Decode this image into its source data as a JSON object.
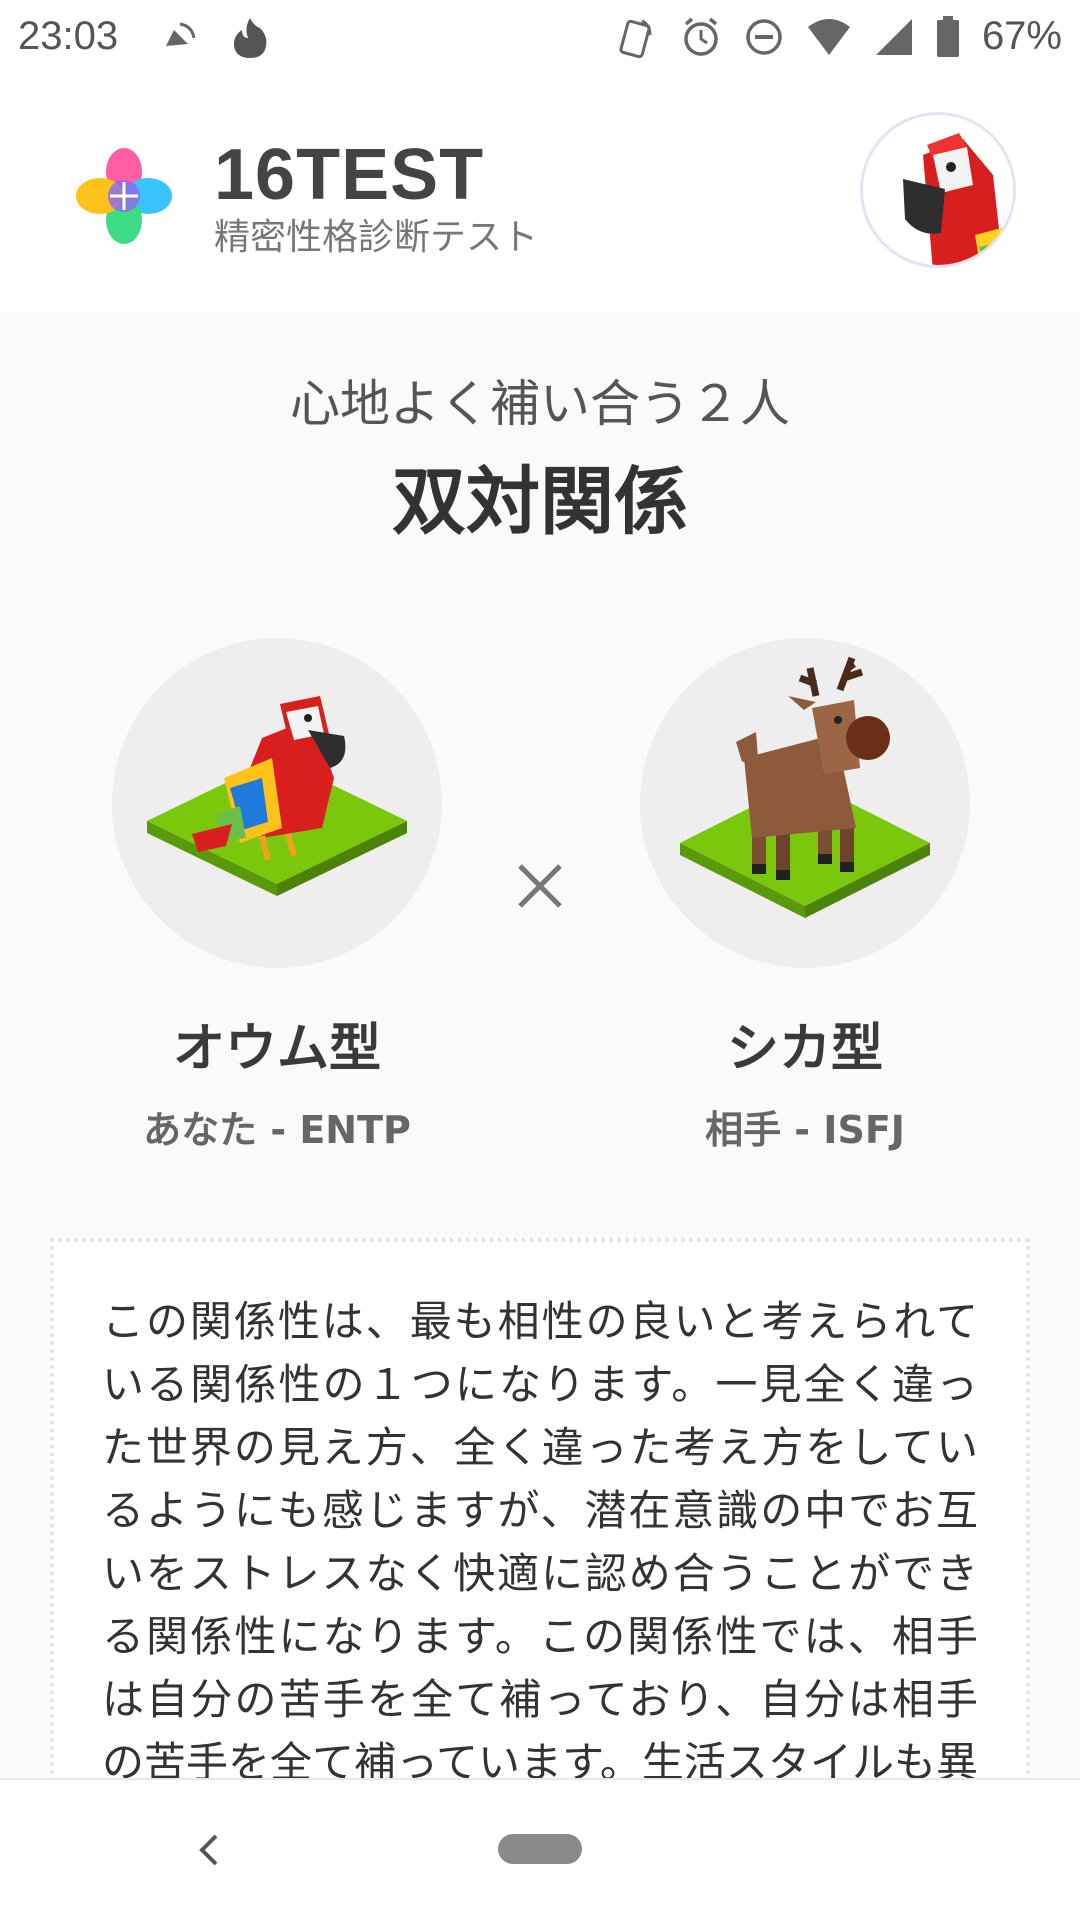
{
  "status_bar": {
    "time": "23:03",
    "battery_percent": "67%",
    "icons": [
      "cast-icon",
      "fire-icon",
      "nfc-icon",
      "alarm-icon",
      "dnd-icon",
      "wifi-icon",
      "signal-icon",
      "battery-icon"
    ]
  },
  "header": {
    "title": "16TEST",
    "subtitle": "精密性格診断テスト",
    "logo_icon": "clover-logo-icon",
    "avatar_icon": "parrot-avatar-icon"
  },
  "relation": {
    "subtitle": "心地よく補い合う２人",
    "title": "双対関係"
  },
  "types": [
    {
      "name": "オウム型",
      "label": "あなた - ENTP",
      "icon": "parrot-icon"
    },
    {
      "name": "シカ型",
      "label": "相手 - ISFJ",
      "icon": "deer-icon"
    }
  ],
  "separator_icon": "times-icon",
  "description": "この関係性は、最も相性の良いと考えられている関係性の１つになります。一見全く違った世界の見え方、全く違った考え方をしているようにも感じますが、潜在意識の中でお互いをストレスなく快適に認め合うことができる関係性になります。この関係性では、相手は自分の苦手を全て補っており、自分は相手の苦手を全て補っています。生活スタイルも異なってはいます",
  "colors": {
    "accent_purple": "#8b6cf0",
    "grass": "#7ac70c",
    "parrot_red": "#d91e1e",
    "deer_brown": "#8d5a3c"
  }
}
